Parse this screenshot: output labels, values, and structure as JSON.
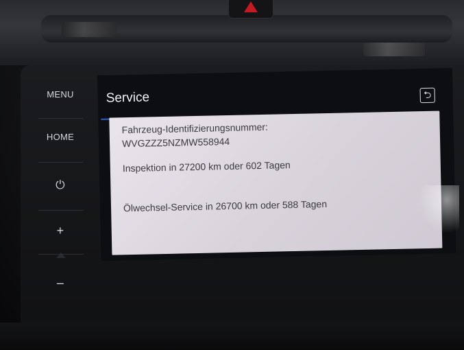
{
  "side_panel": {
    "menu_label": "MENU",
    "home_label": "HOME",
    "power_icon": "⏻",
    "volume_up": "+",
    "volume_down": "–"
  },
  "screen": {
    "title": "Service",
    "back_icon": "⮌",
    "accent_color": "#3b73e8",
    "info": {
      "vin_label": "Fahrzeug-Identifizierungsnummer:",
      "vin_value": "WVGZZZ5NZMW558944",
      "inspection": "Inspektion in 27200 km oder 602 Tagen",
      "oil_service": "Ölwechsel-Service in 26700 km oder 588 Tagen"
    }
  }
}
